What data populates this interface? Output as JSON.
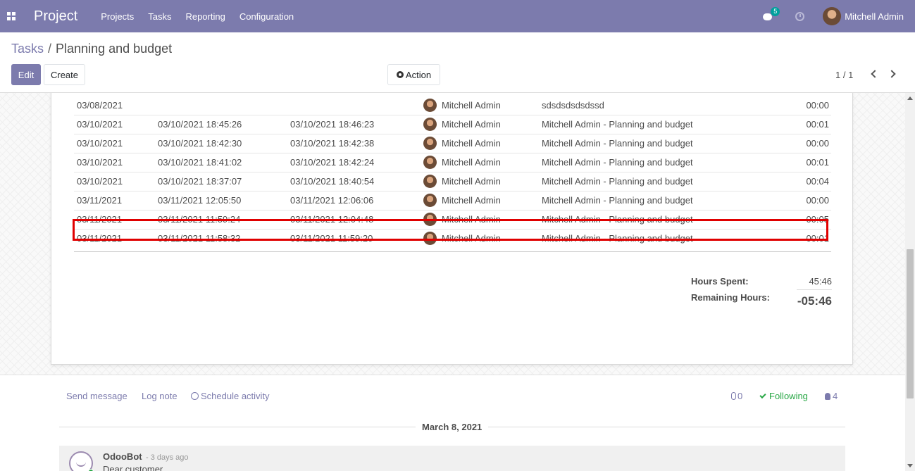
{
  "navbar": {
    "brand": "Project",
    "menu": [
      "Projects",
      "Tasks",
      "Reporting",
      "Configuration"
    ],
    "messages_badge": "5",
    "user_name": "Mitchell Admin"
  },
  "control_panel": {
    "breadcrumb_parent": "Tasks",
    "breadcrumb_separator": "/",
    "breadcrumb_current": "Planning and budget",
    "edit_label": "Edit",
    "create_label": "Create",
    "action_label": "Action",
    "pager_value": "1 / 1"
  },
  "timesheets": [
    {
      "date": "03/08/2021",
      "start": "",
      "end": "",
      "user": "Mitchell Admin",
      "description": "sdsdsdsdsdssd",
      "duration": "00:00"
    },
    {
      "date": "03/10/2021",
      "start": "03/10/2021 18:45:26",
      "end": "03/10/2021 18:46:23",
      "user": "Mitchell Admin",
      "description": "Mitchell Admin - Planning and budget",
      "duration": "00:01"
    },
    {
      "date": "03/10/2021",
      "start": "03/10/2021 18:42:30",
      "end": "03/10/2021 18:42:38",
      "user": "Mitchell Admin",
      "description": "Mitchell Admin - Planning and budget",
      "duration": "00:00"
    },
    {
      "date": "03/10/2021",
      "start": "03/10/2021 18:41:02",
      "end": "03/10/2021 18:42:24",
      "user": "Mitchell Admin",
      "description": "Mitchell Admin - Planning and budget",
      "duration": "00:01"
    },
    {
      "date": "03/10/2021",
      "start": "03/10/2021 18:37:07",
      "end": "03/10/2021 18:40:54",
      "user": "Mitchell Admin",
      "description": "Mitchell Admin - Planning and budget",
      "duration": "00:04"
    },
    {
      "date": "03/11/2021",
      "start": "03/11/2021 12:05:50",
      "end": "03/11/2021 12:06:06",
      "user": "Mitchell Admin",
      "description": "Mitchell Admin - Planning and budget",
      "duration": "00:00"
    },
    {
      "date": "03/11/2021",
      "start": "03/11/2021 11:59:24",
      "end": "03/11/2021 12:04:48",
      "user": "Mitchell Admin",
      "description": "Mitchell Admin - Planning and budget",
      "duration": "00:05"
    },
    {
      "date": "03/11/2021",
      "start": "03/11/2021 11:58:32",
      "end": "03/11/2021 11:59:20",
      "user": "Mitchell Admin",
      "description": "Mitchell Admin - Planning and budget",
      "duration": "00:01"
    }
  ],
  "totals": {
    "hours_spent_label": "Hours Spent:",
    "hours_spent_value": "45:46",
    "remaining_label": "Remaining Hours:",
    "remaining_value": "-05:46"
  },
  "chatter": {
    "send_message": "Send message",
    "log_note": "Log note",
    "schedule_activity": "Schedule activity",
    "attachments_count": "0",
    "following_label": "Following",
    "followers_count": "4",
    "date_separator": "March 8, 2021",
    "message": {
      "author": "OdooBot",
      "time": "- 3 days ago",
      "body": "Dear customer,"
    }
  },
  "colors": {
    "brand": "#7c7bad",
    "highlight": "#e00000",
    "following": "#28a745",
    "badge": "#00a09d"
  }
}
